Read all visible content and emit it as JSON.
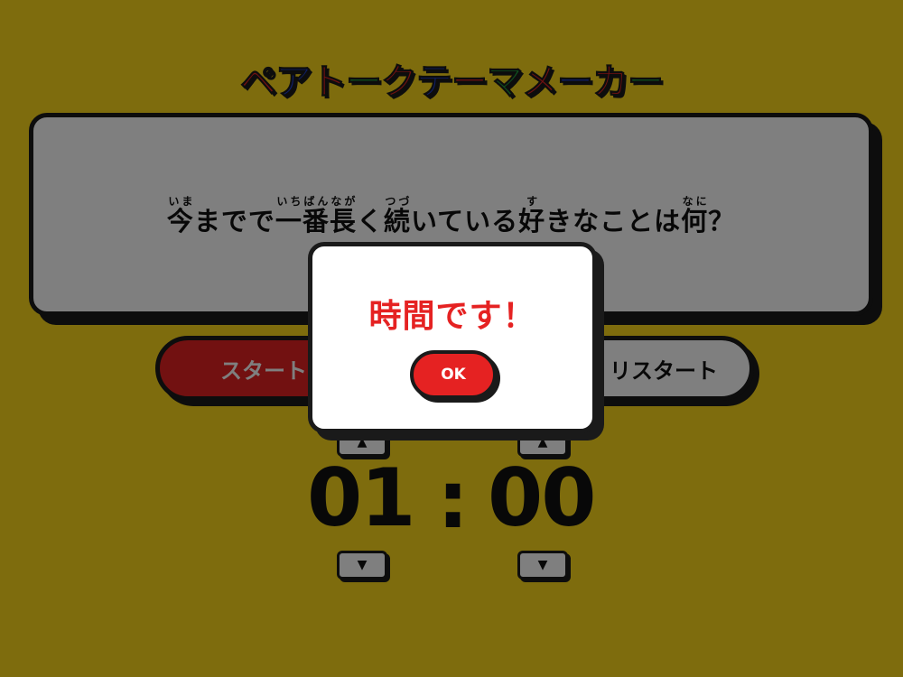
{
  "title": {
    "chars": [
      {
        "text": "ペ",
        "color": "#e52222"
      },
      {
        "text": "ア",
        "color": "#1f3fd0"
      },
      {
        "text": "ト",
        "color": "#e52222"
      },
      {
        "text": "ー",
        "color": "#1f9e3c"
      },
      {
        "text": "ク",
        "color": "#e52222"
      },
      {
        "text": "テ",
        "color": "#1f3fd0"
      },
      {
        "text": "ー",
        "color": "#e52222"
      },
      {
        "text": "マ",
        "color": "#1f9e3c"
      },
      {
        "text": "メ",
        "color": "#e52222"
      },
      {
        "text": "ー",
        "color": "#1f3fd0"
      },
      {
        "text": "カ",
        "color": "#e52222"
      },
      {
        "text": "ー",
        "color": "#1f9e3c"
      }
    ]
  },
  "theme": {
    "segments": [
      {
        "base": "今",
        "ruby": "いま"
      },
      {
        "base": "までで",
        "ruby": ""
      },
      {
        "base": "一番長",
        "ruby": "いちばんなが"
      },
      {
        "base": "く",
        "ruby": ""
      },
      {
        "base": "続",
        "ruby": "つづ"
      },
      {
        "base": "いている",
        "ruby": ""
      },
      {
        "base": "好",
        "ruby": "す"
      },
      {
        "base": "きなことは",
        "ruby": ""
      },
      {
        "base": "何",
        "ruby": "なに"
      },
      {
        "base": "？",
        "ruby": ""
      }
    ]
  },
  "controls": {
    "start_label": "スタート",
    "restart_label": "リスタート"
  },
  "timer": {
    "minutes": "01",
    "separator": ":",
    "seconds": "00",
    "up_arrow": "▲",
    "down_arrow": "▼"
  },
  "modal": {
    "message": "時間です！",
    "ok_label": "OK"
  },
  "colors": {
    "background": "#fdd81b",
    "accent_red": "#e52222",
    "outline": "#1a1a1a"
  }
}
